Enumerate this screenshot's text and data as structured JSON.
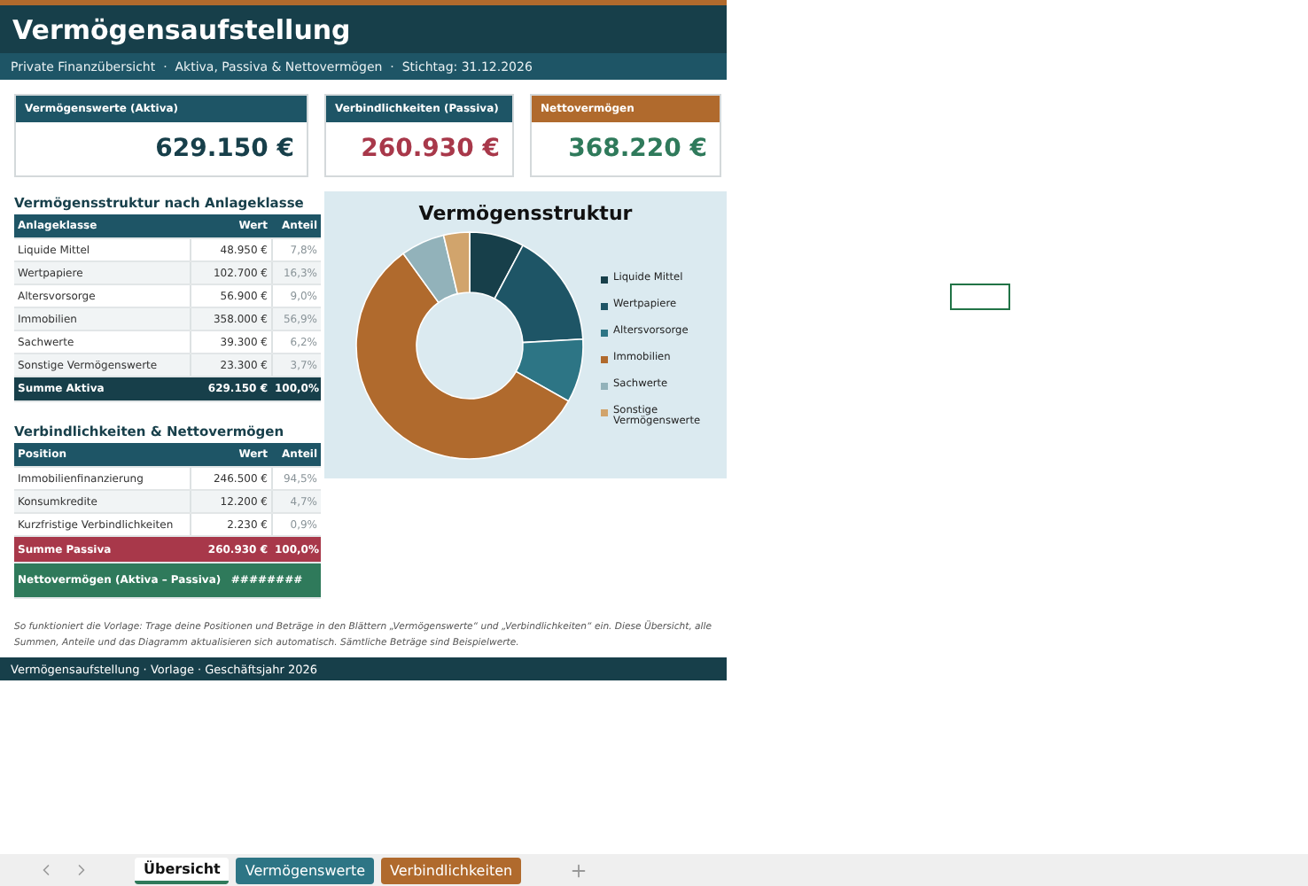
{
  "title": "Vermögensaufstellung",
  "subtitle": "Private Finanzübersicht  ·  Aktiva, Passiva & Nettovermögen  ·  Stichtag: 31.12.2026",
  "cards": [
    {
      "kind": "aktiva",
      "label": "Vermögenswerte (Aktiva)",
      "value": "629.150 €"
    },
    {
      "kind": "passiva",
      "label": "Verbindlichkeiten (Passiva)",
      "value": "260.930 €"
    },
    {
      "kind": "netto",
      "label": "Nettovermögen",
      "value": "368.220 €"
    }
  ],
  "asset_table": {
    "title": "Vermögensstruktur nach Anlageklasse",
    "columns": [
      "Anlageklasse",
      "Wert",
      "Anteil"
    ],
    "rows": [
      {
        "name": "Liquide Mittel",
        "value": "48.950 €",
        "share": "7,8%"
      },
      {
        "name": "Wertpapiere",
        "value": "102.700 €",
        "share": "16,3%"
      },
      {
        "name": "Altersvorsorge",
        "value": "56.900 €",
        "share": "9,0%"
      },
      {
        "name": "Immobilien",
        "value": "358.000 €",
        "share": "56,9%"
      },
      {
        "name": "Sachwerte",
        "value": "39.300 €",
        "share": "6,2%"
      },
      {
        "name": "Sonstige Vermögenswerte",
        "value": "23.300 €",
        "share": "3,7%"
      }
    ],
    "total": {
      "name": "Summe Aktiva",
      "value": "629.150 €",
      "share": "100,0%"
    }
  },
  "liability_table": {
    "title": "Verbindlichkeiten & Nettovermögen",
    "columns": [
      "Position",
      "Wert",
      "Anteil"
    ],
    "rows": [
      {
        "name": "Immobilienfinanzierung",
        "value": "246.500 €",
        "share": "94,5%"
      },
      {
        "name": "Konsumkredite",
        "value": "12.200 €",
        "share": "4,7%"
      },
      {
        "name": "Kurzfristige Verbindlichkeiten",
        "value": "2.230 €",
        "share": "0,9%"
      }
    ],
    "total": {
      "name": "Summe Passiva",
      "value": "260.930 €",
      "share": "100,0%"
    },
    "net": {
      "name": "Nettovermögen (Aktiva – Passiva)",
      "value": "########"
    }
  },
  "chart": {
    "chart_data": {
      "type": "donut",
      "title": "Vermögensstruktur",
      "categories": [
        "Liquide Mittel",
        "Wertpapiere",
        "Altersvorsorge",
        "Immobilien",
        "Sachwerte",
        "Sonstige Vermögenswerte"
      ],
      "values": [
        7.78,
        16.32,
        9.05,
        56.9,
        6.25,
        3.7
      ],
      "legend": "right"
    }
  },
  "note": "So funktioniert die Vorlage:  Trage deine Positionen und Beträge in den Blättern „Vermögenswerte“ und „Verbindlichkeiten“ ein. Diese Übersicht, alle Summen, Anteile und das Diagramm aktualisieren sich automatisch. Sämtliche Beträge sind Beispielwerte.",
  "footer": "Vermögensaufstellung · Vorlage · Geschäftsjahr 2026",
  "sheet_tabs": [
    {
      "label": "Übersicht",
      "selected": true
    },
    {
      "label": "Vermögenswerte",
      "selected": false,
      "color": "#2d7585"
    },
    {
      "label": "Verbindlichkeiten",
      "selected": false,
      "color": "#b06a2d"
    }
  ]
}
